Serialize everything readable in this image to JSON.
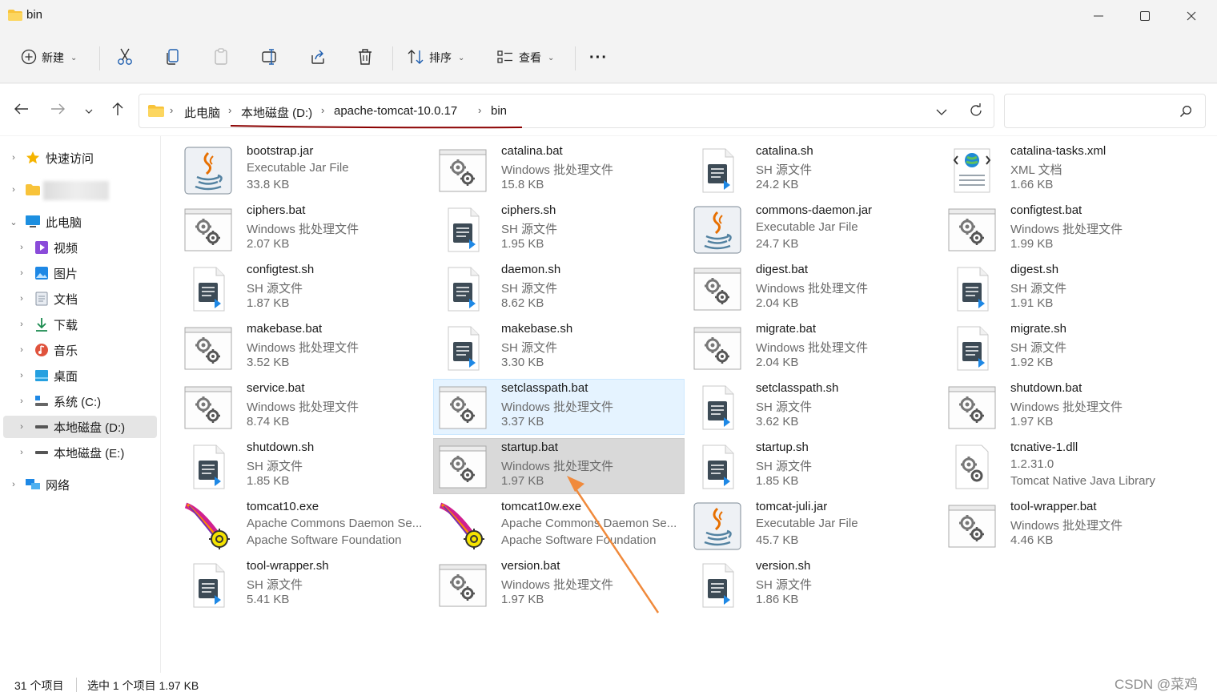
{
  "window": {
    "title": "bin"
  },
  "toolbar": {
    "new_label": "新建",
    "sort_label": "排序",
    "view_label": "查看",
    "more_label": "···"
  },
  "address": {
    "crumbs": [
      "此电脑",
      "本地磁盘 (D:)",
      "apache-tomcat-10.0.17",
      "bin"
    ],
    "search_placeholder": ""
  },
  "sidebar": {
    "items": [
      {
        "label": "快速访问"
      },
      {
        "label": ""
      },
      {
        "label": "此电脑"
      },
      {
        "label": "视频"
      },
      {
        "label": "图片"
      },
      {
        "label": "文档"
      },
      {
        "label": "下载"
      },
      {
        "label": "音乐"
      },
      {
        "label": "桌面"
      },
      {
        "label": "系统 (C:)"
      },
      {
        "label": "本地磁盘 (D:)"
      },
      {
        "label": "本地磁盘 (E:)"
      },
      {
        "label": "网络"
      }
    ]
  },
  "files": [
    {
      "name": "bootstrap.jar",
      "type": "Executable Jar File",
      "size": "33.8 KB",
      "icon": "java-icon"
    },
    {
      "name": "catalina.bat",
      "type": "Windows 批处理文件",
      "size": "15.8 KB",
      "icon": "batch-icon"
    },
    {
      "name": "catalina.sh",
      "type": "SH 源文件",
      "size": "24.2 KB",
      "icon": "sh-icon"
    },
    {
      "name": "catalina-tasks.xml",
      "type": "XML 文档",
      "size": "1.66 KB",
      "icon": "xml-icon"
    },
    {
      "name": "ciphers.bat",
      "type": "Windows 批处理文件",
      "size": "2.07 KB",
      "icon": "batch-icon"
    },
    {
      "name": "ciphers.sh",
      "type": "SH 源文件",
      "size": "1.95 KB",
      "icon": "sh-icon"
    },
    {
      "name": "commons-daemon.jar",
      "type": "Executable Jar File",
      "size": "24.7 KB",
      "icon": "java-icon"
    },
    {
      "name": "configtest.bat",
      "type": "Windows 批处理文件",
      "size": "1.99 KB",
      "icon": "batch-icon"
    },
    {
      "name": "configtest.sh",
      "type": "SH 源文件",
      "size": "1.87 KB",
      "icon": "sh-icon"
    },
    {
      "name": "daemon.sh",
      "type": "SH 源文件",
      "size": "8.62 KB",
      "icon": "sh-icon"
    },
    {
      "name": "digest.bat",
      "type": "Windows 批处理文件",
      "size": "2.04 KB",
      "icon": "batch-icon"
    },
    {
      "name": "digest.sh",
      "type": "SH 源文件",
      "size": "1.91 KB",
      "icon": "sh-icon"
    },
    {
      "name": "makebase.bat",
      "type": "Windows 批处理文件",
      "size": "3.52 KB",
      "icon": "batch-icon"
    },
    {
      "name": "makebase.sh",
      "type": "SH 源文件",
      "size": "3.30 KB",
      "icon": "sh-icon"
    },
    {
      "name": "migrate.bat",
      "type": "Windows 批处理文件",
      "size": "2.04 KB",
      "icon": "batch-icon"
    },
    {
      "name": "migrate.sh",
      "type": "SH 源文件",
      "size": "1.92 KB",
      "icon": "sh-icon"
    },
    {
      "name": "service.bat",
      "type": "Windows 批处理文件",
      "size": "8.74 KB",
      "icon": "batch-icon"
    },
    {
      "name": "setclasspath.bat",
      "type": "Windows 批处理文件",
      "size": "3.37 KB",
      "icon": "batch-icon"
    },
    {
      "name": "setclasspath.sh",
      "type": "SH 源文件",
      "size": "3.62 KB",
      "icon": "sh-icon"
    },
    {
      "name": "shutdown.bat",
      "type": "Windows 批处理文件",
      "size": "1.97 KB",
      "icon": "batch-icon"
    },
    {
      "name": "shutdown.sh",
      "type": "SH 源文件",
      "size": "1.85 KB",
      "icon": "sh-icon"
    },
    {
      "name": "startup.bat",
      "type": "Windows 批处理文件",
      "size": "1.97 KB",
      "icon": "batch-icon"
    },
    {
      "name": "startup.sh",
      "type": "SH 源文件",
      "size": "1.85 KB",
      "icon": "sh-icon"
    },
    {
      "name": "tcnative-1.dll",
      "type": "1.2.31.0",
      "size": "Tomcat Native Java Library",
      "icon": "dll-icon"
    },
    {
      "name": "tomcat10.exe",
      "type": "Apache Commons Daemon Se...",
      "size": "Apache Software Foundation",
      "icon": "feather-icon"
    },
    {
      "name": "tomcat10w.exe",
      "type": "Apache Commons Daemon Se...",
      "size": "Apache Software Foundation",
      "icon": "feather-icon"
    },
    {
      "name": "tomcat-juli.jar",
      "type": "Executable Jar File",
      "size": "45.7 KB",
      "icon": "java-icon"
    },
    {
      "name": "tool-wrapper.bat",
      "type": "Windows 批处理文件",
      "size": "4.46 KB",
      "icon": "batch-icon"
    },
    {
      "name": "tool-wrapper.sh",
      "type": "SH 源文件",
      "size": "5.41 KB",
      "icon": "sh-icon"
    },
    {
      "name": "version.bat",
      "type": "Windows 批处理文件",
      "size": "1.97 KB",
      "icon": "batch-icon"
    },
    {
      "name": "version.sh",
      "type": "SH 源文件",
      "size": "1.86 KB",
      "icon": "sh-icon"
    }
  ],
  "status": {
    "count": "31 个项目",
    "selection": "选中 1 个项目  1.97 KB"
  },
  "watermark": "CSDN @菜鸡",
  "colors": {
    "accent": "#0067c0",
    "folder": "#f8c33a",
    "selection": "#d9d9d9",
    "hover": "#e5f3ff",
    "annotation_arrow": "#f08a3c",
    "annotation_underline": "#8b0000"
  }
}
